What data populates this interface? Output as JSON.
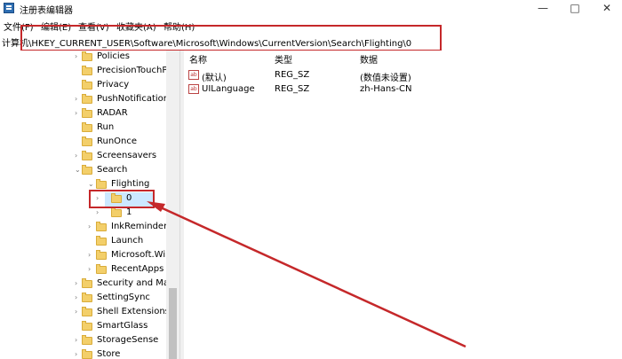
{
  "window": {
    "title": "注册表编辑器",
    "controls": {
      "minimize": "—",
      "maximize": "□",
      "close": "✕"
    }
  },
  "menu": [
    "文件(F)",
    "编辑(E)",
    "查看(V)",
    "收藏夹(A)",
    "帮助(H)"
  ],
  "address": "计算机\\HKEY_CURRENT_USER\\Software\\Microsoft\\Windows\\CurrentVersion\\Search\\Flighting\\0",
  "tree": [
    {
      "label": "Policies",
      "expander": "collapsed"
    },
    {
      "label": "PrecisionTouchPa",
      "expander": "none"
    },
    {
      "label": "Privacy",
      "expander": "none"
    },
    {
      "label": "PushNotifications",
      "expander": "collapsed"
    },
    {
      "label": "RADAR",
      "expander": "collapsed"
    },
    {
      "label": "Run",
      "expander": "none"
    },
    {
      "label": "RunOnce",
      "expander": "none"
    },
    {
      "label": "Screensavers",
      "expander": "collapsed"
    },
    {
      "label": "Search",
      "expander": "expanded"
    },
    {
      "label": "Flighting",
      "expander": "expanded"
    },
    {
      "label": "0",
      "expander": "collapsed",
      "selected": true
    },
    {
      "label": "1",
      "expander": "collapsed"
    },
    {
      "label": "InkReminder",
      "expander": "collapsed"
    },
    {
      "label": "Launch",
      "expander": "none"
    },
    {
      "label": "Microsoft.Wind",
      "expander": "collapsed"
    },
    {
      "label": "RecentApps",
      "expander": "collapsed"
    },
    {
      "label": "Security and Main",
      "expander": "collapsed"
    },
    {
      "label": "SettingSync",
      "expander": "collapsed"
    },
    {
      "label": "Shell Extensions",
      "expander": "collapsed"
    },
    {
      "label": "SmartGlass",
      "expander": "none"
    },
    {
      "label": "StorageSense",
      "expander": "collapsed"
    },
    {
      "label": "Store",
      "expander": "collapsed"
    }
  ],
  "values_table": {
    "columns": [
      "名称",
      "类型",
      "数据"
    ],
    "rows": [
      {
        "name": "(默认)",
        "type": "REG_SZ",
        "data": "(数值未设置)"
      },
      {
        "name": "UILanguage",
        "type": "REG_SZ",
        "data": "zh-Hans-CN"
      }
    ]
  },
  "value_icon_text": "ab",
  "colors": {
    "annotation": "#c5282a",
    "folder": "#f3cf6a",
    "selection": "#cce8ff"
  }
}
